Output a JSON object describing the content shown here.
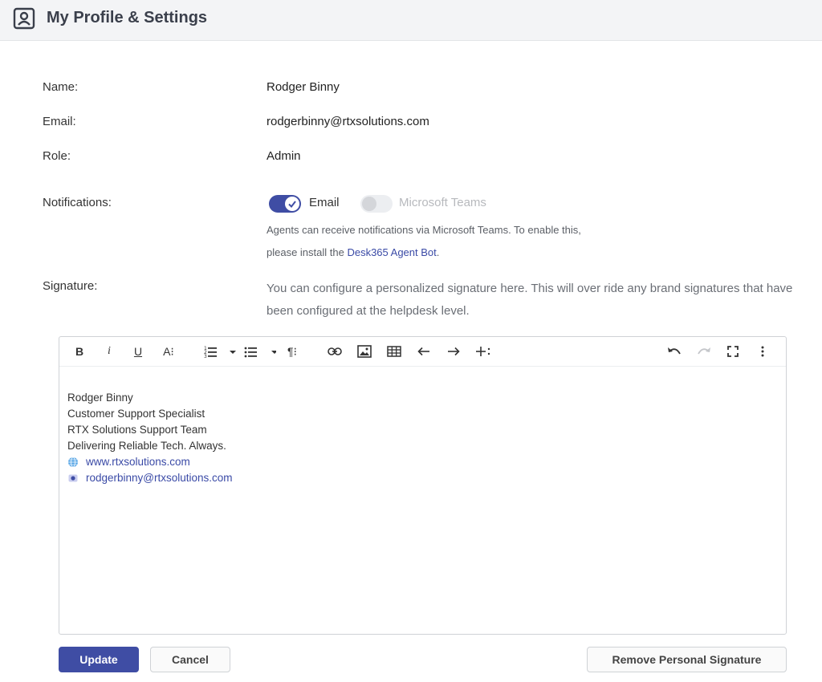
{
  "header": {
    "title": "My Profile & Settings",
    "icon": "profile-icon"
  },
  "profile": {
    "name_label": "Name:",
    "name_value": "Rodger Binny",
    "email_label": "Email:",
    "email_value": "rodgerbinny@rtxsolutions.com",
    "role_label": "Role:",
    "role_value": "Admin"
  },
  "notifications": {
    "label": "Notifications:",
    "email_toggle": {
      "label": "Email",
      "on": true
    },
    "teams_toggle": {
      "label": "Microsoft Teams",
      "on": false,
      "disabled": true
    },
    "help_line1": "Agents can receive notifications via Microsoft Teams. To enable this,",
    "help_line2_prefix": "please install the ",
    "help_link": "Desk365 Agent Bot",
    "help_line2_suffix": "."
  },
  "signature": {
    "label": "Signature:",
    "description": "You can configure a personalized signature here. This will over ride any brand signatures that have been configured at the helpdesk level.",
    "lines": [
      "Rodger Binny",
      "Customer Support Specialist",
      "RTX Solutions Support Team",
      "Delivering Reliable Tech. Always."
    ],
    "website": "www.rtxsolutions.com",
    "email": "rodgerbinny@rtxsolutions.com"
  },
  "toolbar": {
    "bold": "B",
    "italic": "i",
    "underline": "U",
    "font_size": "A⁝",
    "paragraph": "¶⁝"
  },
  "buttons": {
    "update": "Update",
    "cancel": "Cancel",
    "remove": "Remove Personal Signature"
  },
  "colors": {
    "accent": "#3f4da4",
    "link": "#3a4aa6"
  }
}
